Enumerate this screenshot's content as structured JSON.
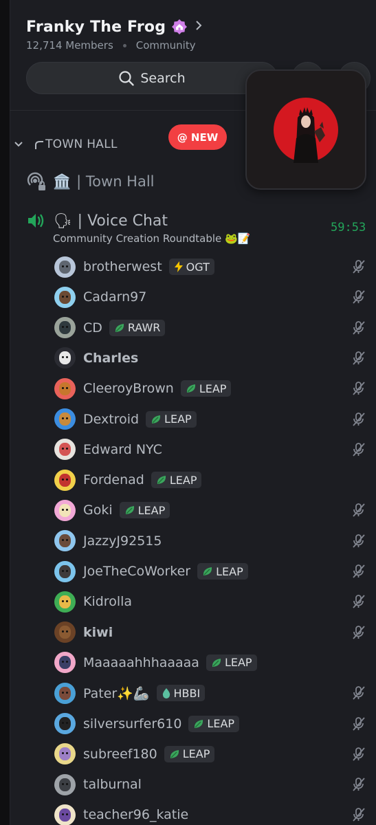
{
  "server": {
    "name": "Franky The Frog",
    "members": "12,714 Members",
    "type": "Community"
  },
  "search": {
    "label": "Search"
  },
  "new_badge": {
    "label": "@ NEW"
  },
  "category": {
    "name": "TOWN HALL"
  },
  "channels": {
    "town_hall": {
      "emoji": "🏛️",
      "name": "| Town Hall"
    },
    "voice_chat": {
      "emoji": "🗣",
      "name": "| Voice Chat",
      "timer": "59:53",
      "status": "Community Creation Roundtable 🐸📝"
    }
  },
  "members": [
    {
      "name": "brotherwest",
      "tag": "OGT",
      "tag_icon": "lightning-icon",
      "muted": true,
      "avatar_bg": "#b8c6d9",
      "face": "#5f6670"
    },
    {
      "name": "Cadarn97",
      "tag": "",
      "muted": true,
      "avatar_bg": "#8fd0ef",
      "face": "#6b4a33"
    },
    {
      "name": "CD",
      "tag": "RAWR",
      "tag_icon": "leaf-icon",
      "muted": true,
      "avatar_bg": "#9aa39a",
      "face": "#2f3a3e"
    },
    {
      "name": "Charles",
      "tag": "",
      "muted": true,
      "bold": true,
      "avatar_bg": "#2b2c33",
      "face": "#e8e8e8"
    },
    {
      "name": "CleeroyBrown",
      "tag": "LEAP",
      "tag_icon": "leaf-icon",
      "muted": true,
      "avatar_bg": "#e9625a",
      "face": "#c7772d"
    },
    {
      "name": "Dextroid",
      "tag": "LEAP",
      "tag_icon": "leaf-icon",
      "muted": true,
      "avatar_bg": "#3c8de0",
      "face": "#c98a3c"
    },
    {
      "name": "Edward NYC",
      "tag": "",
      "muted": true,
      "avatar_bg": "#e7e3de",
      "face": "#d45454"
    },
    {
      "name": "Fordenad",
      "tag": "LEAP",
      "tag_icon": "leaf-icon",
      "muted": false,
      "avatar_bg": "#f1d04a",
      "face": "#c2342f"
    },
    {
      "name": "Goki",
      "tag": "LEAP",
      "tag_icon": "leaf-icon",
      "muted": true,
      "avatar_bg": "#f2a8d6",
      "face": "#f2e4b8"
    },
    {
      "name": "JazzyJ92515",
      "tag": "",
      "muted": true,
      "avatar_bg": "#8fc6ee",
      "face": "#6a4b3a"
    },
    {
      "name": "JoeTheCoWorker",
      "tag": "LEAP",
      "tag_icon": "leaf-icon",
      "muted": true,
      "avatar_bg": "#7cc4ec",
      "face": "#3e3a3a"
    },
    {
      "name": "Kidrolla",
      "tag": "",
      "muted": true,
      "avatar_bg": "#3fae55",
      "face": "#e8b948"
    },
    {
      "name": "kiwi",
      "tag": "",
      "muted": true,
      "bold": true,
      "avatar_bg": "#6b4226",
      "face": "#8a5a32"
    },
    {
      "name": "Maaaaahhhaaaaa",
      "tag": "LEAP",
      "tag_icon": "leaf-icon",
      "muted": false,
      "avatar_bg": "#f1a7c8",
      "face": "#3a3f66"
    },
    {
      "name": "Pater✨🦾",
      "tag": "HBBI",
      "tag_icon": "drop-icon",
      "muted": true,
      "avatar_bg": "#4aa0d6",
      "face": "#7a4a3a"
    },
    {
      "name": "silversurfer610",
      "tag": "LEAP",
      "tag_icon": "leaf-icon",
      "muted": true,
      "avatar_bg": "#5aa8e0",
      "face": "#222"
    },
    {
      "name": "subreef180",
      "tag": "LEAP",
      "tag_icon": "leaf-icon",
      "muted": true,
      "avatar_bg": "#e9d78a",
      "face": "#9c7fc6"
    },
    {
      "name": "talburnal",
      "tag": "",
      "muted": true,
      "avatar_bg": "#9ea3a8",
      "face": "#3c3f44"
    },
    {
      "name": "teacher96_katie",
      "tag": "",
      "muted": true,
      "avatar_bg": "#efe4c9",
      "face": "#6b4aa0"
    }
  ],
  "colors": {
    "accent_green": "#23a55a",
    "new_red": "#f23f42",
    "tag_leaf": "#3ba55d"
  }
}
